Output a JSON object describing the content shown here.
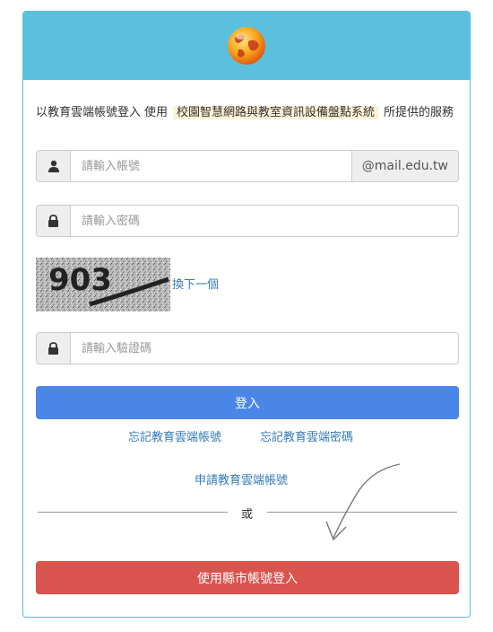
{
  "intro": {
    "prefix": "以教育雲端帳號登入",
    "use": "使用",
    "system_name": "校園智慧網路與教室資訊設備盤點系統",
    "suffix": "所提供的服務"
  },
  "account": {
    "placeholder": "請輸入帳號",
    "domain": "@mail.edu.tw"
  },
  "password": {
    "placeholder": "請輸入密碼"
  },
  "captcha": {
    "image_text": "903",
    "refresh_label": "換下一個",
    "placeholder": "請輸入驗證碼"
  },
  "login_button": "登入",
  "forgot_account": "忘記教育雲端帳號",
  "forgot_password": "忘記教育雲端密碼",
  "apply_account": "申請教育雲端帳號",
  "or_label": "或",
  "city_login_button": "使用縣市帳號登入",
  "colors": {
    "header": "#5bc0de",
    "primary": "#4a86e8",
    "danger": "#d9534f",
    "link": "#337ab7"
  }
}
